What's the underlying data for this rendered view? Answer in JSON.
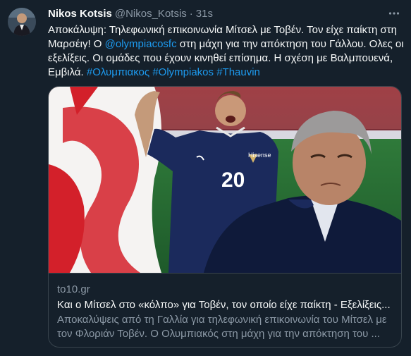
{
  "author": {
    "name": "Nikos Kotsis",
    "handle": "@Nikos_Kotsis",
    "separator": "·",
    "time": "31s"
  },
  "more_icon": "more-horizontal-icon",
  "tweet_text": {
    "part1": "Αποκάλυψη: Τηλεφωνική επικοινωνία Μίτσελ με Τοβέν. Τον είχε παίκτη στη Μαρσέιγ! Ο ",
    "mention": "@olympiacosfc",
    "part2": " στη μάχη για την απόκτηση του Γάλλου. Ολες οι εξελίξεις. Οι ομάδες που έχουν κινηθεί επίσημα. Η σχέση με Βαλμπουενά, Εμβιλά. ",
    "hashtag1": "#Ολυμπιακος",
    "hashtag2": "#Olympiakos",
    "hashtag3": "#Thauvin"
  },
  "card": {
    "domain": "to10.gr",
    "title": "Και ο Μίτσελ στο «κόλπο» για Τοβέν, τον οποίο είχε παίκτη - Εξελίξεις...",
    "description": "Αποκαλύψεις από τη Γαλλία για τηλεφωνική επικοινωνία του Μίτσελ με τον Φλοριάν Τοβέν. Ο Ολυμπιακός στη μάχη για την απόκτηση του ...",
    "image_text": {
      "jersey_number": "20",
      "sponsor": "Hisense"
    }
  },
  "colors": {
    "background": "#15202b",
    "link": "#1d9bf0",
    "muted": "#8b98a5",
    "border": "#38444d",
    "olympiacos_red": "#d3202a",
    "france_blue": "#1b2a5c"
  }
}
